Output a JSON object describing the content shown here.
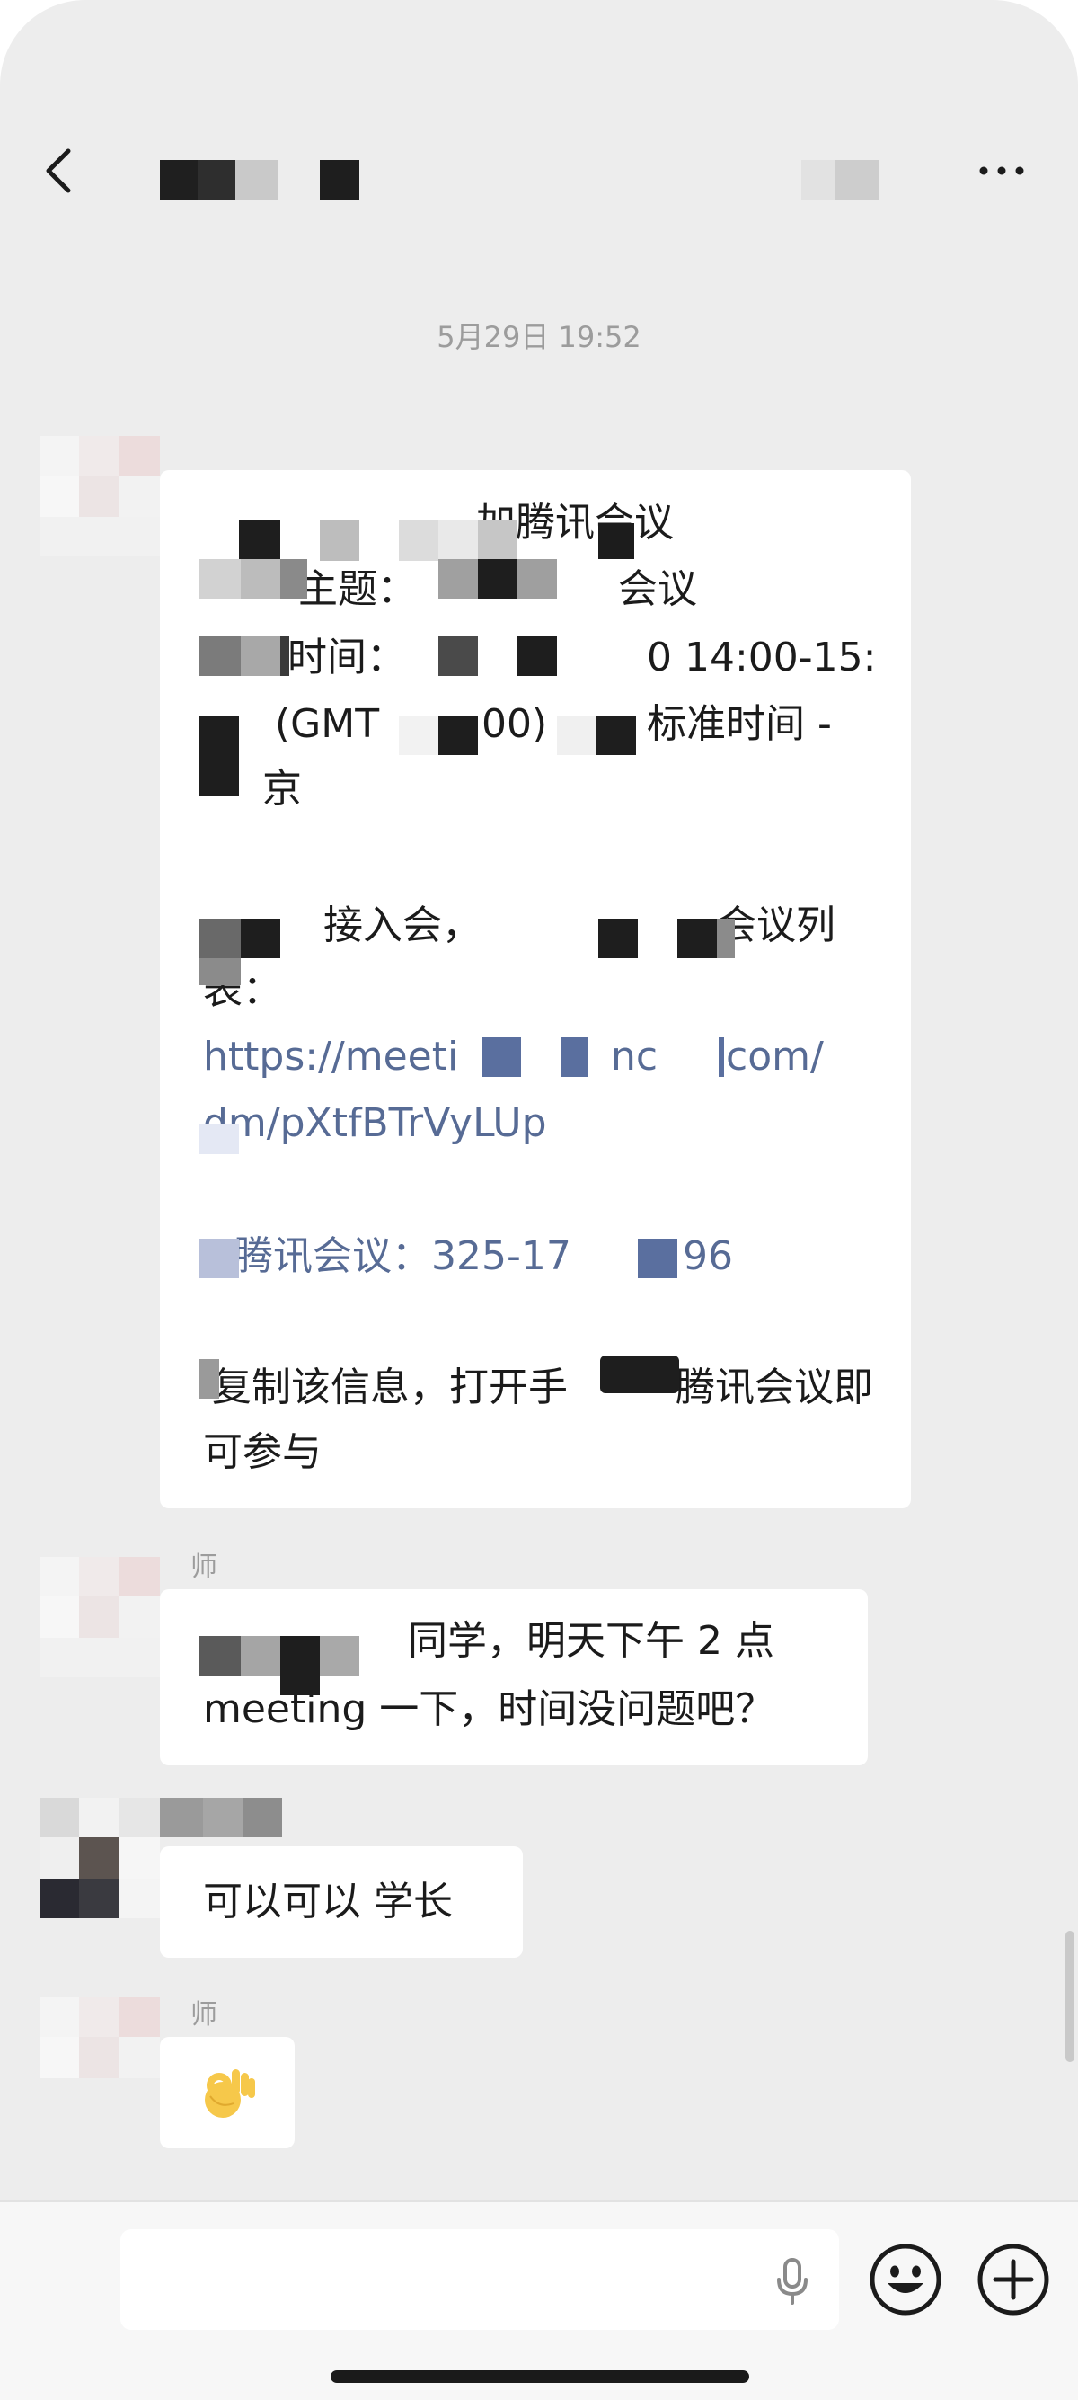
{
  "header": {
    "back_icon": "chevron-left-icon",
    "more_icon": "ellipsis-icon"
  },
  "chat": {
    "timestamp": "5月29日 19:52",
    "messages": [
      {
        "sender": "",
        "lines": [
          "加腾讯会议",
          "主题：",
          "会议",
          "时间：",
          "0 14:00-15:",
          "(GMT",
          "00)",
          "标准时间 -",
          "京",
          "接入会，",
          "会议列",
          "表：",
          "https://meeti",
          "nc",
          "com/",
          "dm/pXtfBTrVyLUp",
          "腾讯会议：325-17",
          "96",
          "复制该信息，打开手",
          "腾讯会议即",
          "可参与"
        ]
      },
      {
        "sender": "师",
        "lines": [
          "同学，明天下午 2 点",
          "meeting 一下，时间没问题吧？"
        ]
      },
      {
        "sender": "",
        "lines": [
          "可以可以 学长"
        ]
      },
      {
        "sender": "师",
        "emoji": "👌",
        "emoji_name": "ok-hand"
      }
    ]
  },
  "input_bar": {
    "voice_icon": "microphone-icon",
    "emoji_icon": "smiley-icon",
    "plus_icon": "plus-circle-icon",
    "text_value": ""
  },
  "colors": {
    "background": "#ededed",
    "bubble": "#ffffff",
    "link": "#576b95",
    "timestamp": "#9c9c9c"
  }
}
